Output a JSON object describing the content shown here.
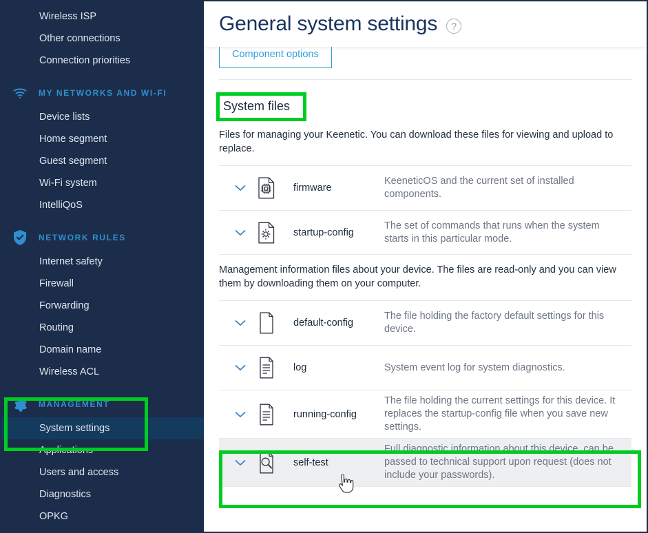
{
  "sidebar": {
    "top_items": [
      {
        "label": "Wireless ISP",
        "name": "sidebar-item-wireless-isp"
      },
      {
        "label": "Other connections",
        "name": "sidebar-item-other-connections"
      },
      {
        "label": "Connection priorities",
        "name": "sidebar-item-connection-priorities"
      }
    ],
    "sections": [
      {
        "title": "MY NETWORKS AND WI-FI",
        "icon": "wifi-icon",
        "items": [
          {
            "label": "Device lists"
          },
          {
            "label": "Home segment"
          },
          {
            "label": "Guest segment"
          },
          {
            "label": "Wi-Fi system"
          },
          {
            "label": "IntelliQoS"
          }
        ]
      },
      {
        "title": "NETWORK RULES",
        "icon": "shield-check-icon",
        "items": [
          {
            "label": "Internet safety"
          },
          {
            "label": "Firewall"
          },
          {
            "label": "Forwarding"
          },
          {
            "label": "Routing"
          },
          {
            "label": "Domain name"
          },
          {
            "label": "Wireless ACL"
          }
        ]
      },
      {
        "title": "MANAGEMENT",
        "icon": "gear-icon",
        "items": [
          {
            "label": "System settings",
            "active": true
          },
          {
            "label": "Applications"
          },
          {
            "label": "Users and access"
          },
          {
            "label": "Diagnostics"
          },
          {
            "label": "OPKG"
          }
        ]
      }
    ]
  },
  "header": {
    "title": "General system settings",
    "help_icon": "question-mark-icon",
    "help_glyph": "?"
  },
  "toolbar": {
    "component_options_label": "Component options"
  },
  "system_files": {
    "heading": "System files",
    "intro": "Files for managing your Keenetic. You can download these files for viewing and upload to replace.",
    "editable_files": [
      {
        "name": "firmware",
        "icon": "chip-document-icon",
        "description": "KeeneticOS and the current set of installed components."
      },
      {
        "name": "startup-config",
        "icon": "gear-document-icon",
        "description": "The set of commands that runs when the system starts in this particular mode."
      }
    ],
    "readonly_intro": "Management information files about your device. The files are read-only and you can view them by downloading them on your computer.",
    "readonly_files": [
      {
        "name": "default-config",
        "icon": "blank-document-icon",
        "description": "The file holding the factory default settings for this device."
      },
      {
        "name": "log",
        "icon": "lined-document-icon",
        "description": "System event log for system diagnostics."
      },
      {
        "name": "running-config",
        "icon": "lined-document-icon",
        "description": "The file holding the current settings for this device. It replaces the startup-config file when you save new settings."
      },
      {
        "name": "self-test",
        "icon": "magnifier-document-icon",
        "description": "Full diagnostic information about this device, can be passed to technical support upon request (does not include your passwords).",
        "hovered": true
      }
    ]
  },
  "annotations": {
    "highlight_color": "#00cc22",
    "highlighted": [
      "System files",
      "MANAGEMENT",
      "System settings",
      "self-test"
    ]
  },
  "colors": {
    "sidebar_bg": "#1b2d4a",
    "sidebar_active_bg": "#143a5e",
    "accent_blue": "#2e9fd8",
    "title_navy": "#18345c",
    "muted_text": "#6d7684"
  },
  "cursor": {
    "type": "pointing-hand-cursor"
  }
}
